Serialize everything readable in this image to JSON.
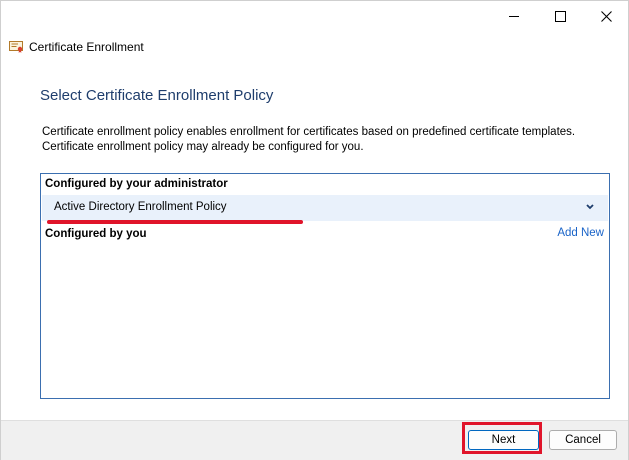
{
  "window": {
    "title": "Certificate Enrollment",
    "caption": {
      "minimize": "minimize-icon",
      "maximize": "maximize-icon",
      "close": "close-icon"
    }
  },
  "page": {
    "heading": "Select Certificate Enrollment Policy",
    "description": "Certificate enrollment policy enables enrollment for certificates based on predefined certificate templates. Certificate enrollment policy may already be configured for you."
  },
  "policies": {
    "admin_group_label": "Configured by your administrator",
    "admin_policy": "Active Directory Enrollment Policy",
    "user_group_label": "Configured by you",
    "add_new": "Add New"
  },
  "footer": {
    "next_label": "Next",
    "cancel_label": "Cancel"
  },
  "colors": {
    "heading": "#1e3d6c",
    "link": "#1a64c8",
    "highlight": "#e0142a",
    "selection": "#e9f1fb"
  }
}
